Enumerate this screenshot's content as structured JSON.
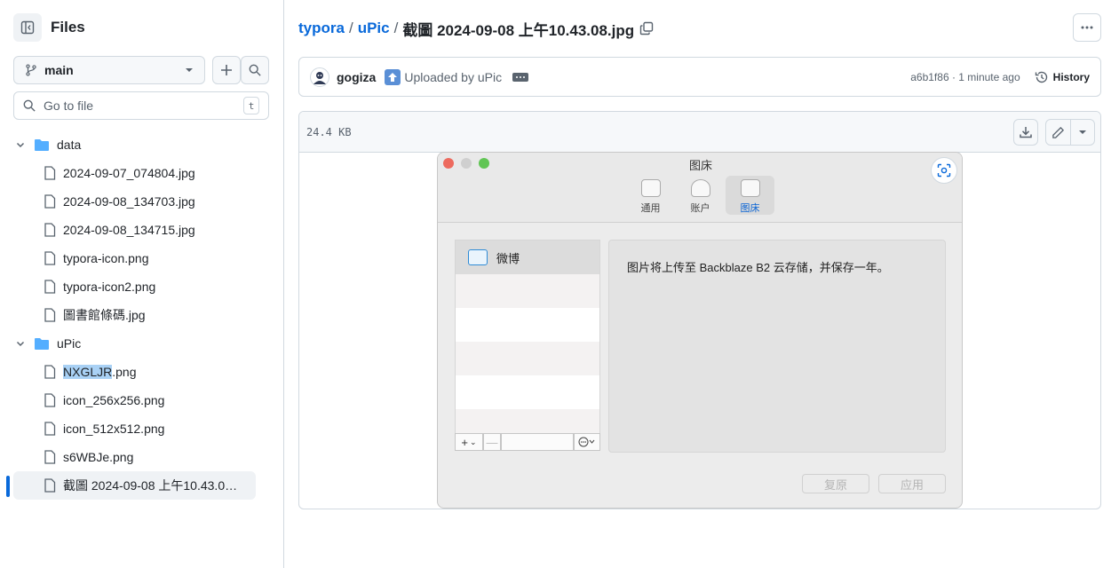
{
  "sidebar": {
    "title": "Files",
    "branch": "main",
    "goto_placeholder": "Go to file",
    "goto_shortcut": "t",
    "tree": [
      {
        "type": "folder",
        "name": "data",
        "depth": 0
      },
      {
        "type": "file",
        "name": "2024-09-07_074804.jpg",
        "depth": 1
      },
      {
        "type": "file",
        "name": "2024-09-08_134703.jpg",
        "depth": 1
      },
      {
        "type": "file",
        "name": "2024-09-08_134715.jpg",
        "depth": 1
      },
      {
        "type": "file",
        "name": "typora-icon.png",
        "depth": 1
      },
      {
        "type": "file",
        "name": "typora-icon2.png",
        "depth": 1
      },
      {
        "type": "file",
        "name": "圖書館條碼.jpg",
        "depth": 1
      },
      {
        "type": "folder",
        "name": "uPic",
        "depth": 0
      },
      {
        "type": "file",
        "name_highlight": "NXGLJR",
        "name_rest": ".png",
        "depth": 1
      },
      {
        "type": "file",
        "name": "icon_256x256.png",
        "depth": 1
      },
      {
        "type": "file",
        "name": "icon_512x512.png",
        "depth": 1
      },
      {
        "type": "file",
        "name": "s6WBJe.png",
        "depth": 1
      },
      {
        "type": "file",
        "name": "截圖 2024-09-08 上午10.43.0…",
        "depth": 1,
        "selected": true
      }
    ]
  },
  "breadcrumb": {
    "repo": "typora",
    "folder": "uPic",
    "file": "截圖 2024-09-08 上午10.43.08.jpg",
    "sep": "/"
  },
  "commit": {
    "author": "gogiza",
    "message": "Uploaded by uPic",
    "meta": "a6b1f86 · 1 minute ago",
    "history_label": "History"
  },
  "file": {
    "size": "24.4 KB"
  },
  "preview": {
    "window_title": "图床",
    "tabs": [
      {
        "label": "通用",
        "active": false
      },
      {
        "label": "账户",
        "active": false
      },
      {
        "label": "图床",
        "active": true
      }
    ],
    "list_item": "微博",
    "description": "图片将上传至 Backblaze B2 云存储，并保存一年。",
    "add_label": "+",
    "remove_label": "—",
    "restore_label": "复原",
    "apply_label": "应用"
  },
  "colors": {
    "accent": "#0969da",
    "folder": "#54aeff",
    "border": "#d1d9e0",
    "muted": "#59636e"
  }
}
